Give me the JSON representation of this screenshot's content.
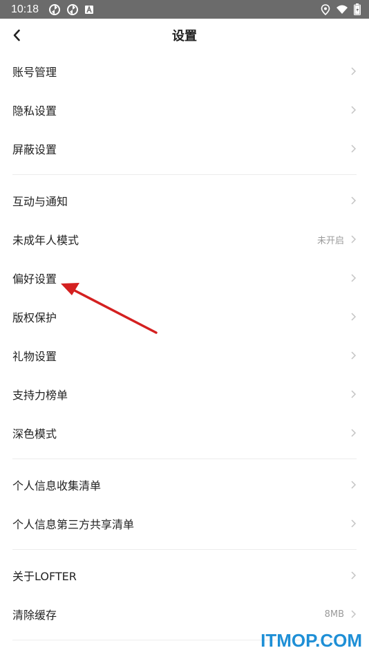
{
  "status_bar": {
    "time": "10:18"
  },
  "header": {
    "title": "设置"
  },
  "groups": [
    {
      "items": [
        {
          "label": "账号管理",
          "value": ""
        },
        {
          "label": "隐私设置",
          "value": ""
        },
        {
          "label": "屏蔽设置",
          "value": ""
        }
      ]
    },
    {
      "items": [
        {
          "label": "互动与通知",
          "value": ""
        },
        {
          "label": "未成年人模式",
          "value": "未开启"
        },
        {
          "label": "偏好设置",
          "value": ""
        },
        {
          "label": "版权保护",
          "value": ""
        },
        {
          "label": "礼物设置",
          "value": ""
        },
        {
          "label": "支持力榜单",
          "value": ""
        },
        {
          "label": "深色模式",
          "value": ""
        }
      ]
    },
    {
      "items": [
        {
          "label": "个人信息收集清单",
          "value": ""
        },
        {
          "label": "个人信息第三方共享清单",
          "value": ""
        }
      ]
    },
    {
      "items": [
        {
          "label": "关于LOFTER",
          "value": ""
        },
        {
          "label": "清除缓存",
          "value": "8MB"
        }
      ]
    }
  ],
  "watermark": "ITMOP.COM",
  "colors": {
    "status_bar": "#6b6b6b",
    "annotation_arrow": "#d42020",
    "watermark": "#1e8fd6"
  }
}
